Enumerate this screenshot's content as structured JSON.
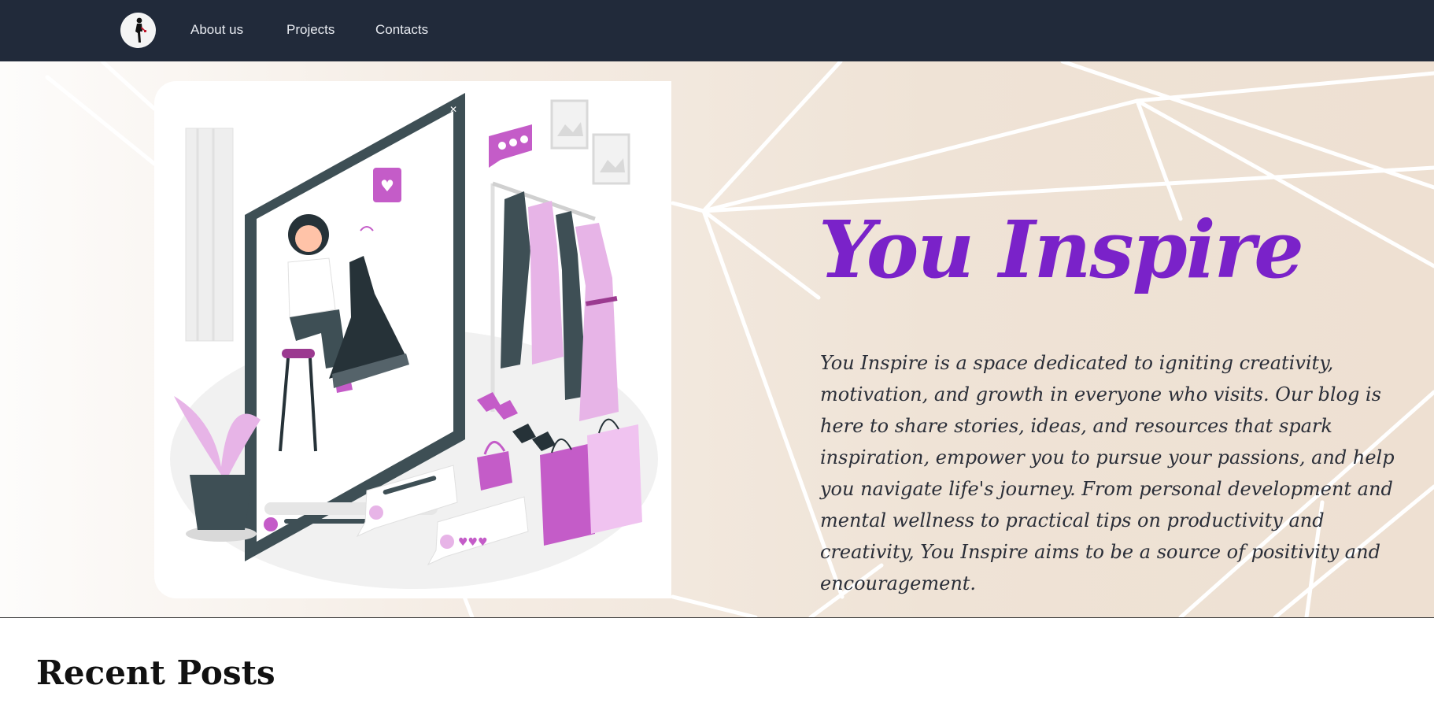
{
  "nav": {
    "logo_icon": "fashion-woman-logo-icon",
    "links": [
      {
        "label": "About us"
      },
      {
        "label": "Projects"
      },
      {
        "label": "Contacts"
      }
    ]
  },
  "hero": {
    "title": "You Inspire",
    "description": "You Inspire is a space dedicated to igniting creativity, motivation, and growth in everyone who visits. Our blog is here to share stories, ideas, and resources that spark inspiration, empower you to pursue your passions, and help you navigate life's journey. From personal development and mental wellness to practical tips on productivity and creativity, You Inspire aims to be a source of positivity and encouragement.",
    "illustration_icon": "fashion-shopping-illustration",
    "colors": {
      "title": "#7a22c9",
      "accent": "#c45cc8",
      "dark": "#3e4f55"
    }
  },
  "posts": {
    "heading": "Recent Posts"
  },
  "colors": {
    "navbar": "#212a3a"
  }
}
